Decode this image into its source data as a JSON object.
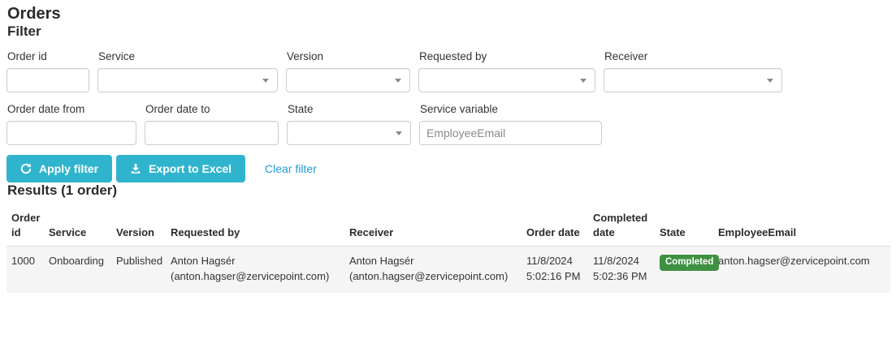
{
  "page": {
    "title": "Orders"
  },
  "filter": {
    "heading": "Filter",
    "fields": {
      "order_id": {
        "label": "Order id",
        "value": ""
      },
      "service": {
        "label": "Service",
        "value": ""
      },
      "version": {
        "label": "Version",
        "value": ""
      },
      "requested_by": {
        "label": "Requested by",
        "value": ""
      },
      "receiver": {
        "label": "Receiver",
        "value": ""
      },
      "order_date_from": {
        "label": "Order date from",
        "value": ""
      },
      "order_date_to": {
        "label": "Order date to",
        "value": ""
      },
      "state": {
        "label": "State",
        "value": ""
      },
      "service_variable": {
        "label": "Service variable",
        "value": "EmployeeEmail"
      }
    },
    "buttons": {
      "apply": {
        "label": "Apply filter",
        "icon": "refresh-icon"
      },
      "export": {
        "label": "Export to Excel",
        "icon": "download-icon"
      },
      "clear": {
        "label": "Clear filter"
      }
    }
  },
  "results": {
    "heading": "Results (1 order)",
    "table": {
      "columns": [
        "Order id",
        "Service",
        "Version",
        "Requested by",
        "Receiver",
        "Order date",
        "Completed date",
        "State",
        "EmployeeEmail"
      ],
      "rows": [
        {
          "order_id": "1000",
          "service": "Onboarding",
          "version": "Published",
          "requested_by_name": "Anton Hagsér",
          "requested_by_email": "(anton.hagser@zervicepoint.com)",
          "receiver_name": "Anton Hagsér",
          "receiver_email": "(anton.hagser@zervicepoint.com)",
          "order_date": "11/8/2024",
          "order_time": "5:02:16 PM",
          "completed_date": "11/8/2024",
          "completed_time": "5:02:36 PM",
          "state": "Completed",
          "employee_email": "anton.hagser@zervicepoint.com"
        }
      ]
    }
  },
  "colors": {
    "accent_teal": "#30b4ce",
    "link_blue": "#1f9cd9",
    "badge_green": "#3f9142",
    "row_stripe": "#f5f5f5"
  }
}
